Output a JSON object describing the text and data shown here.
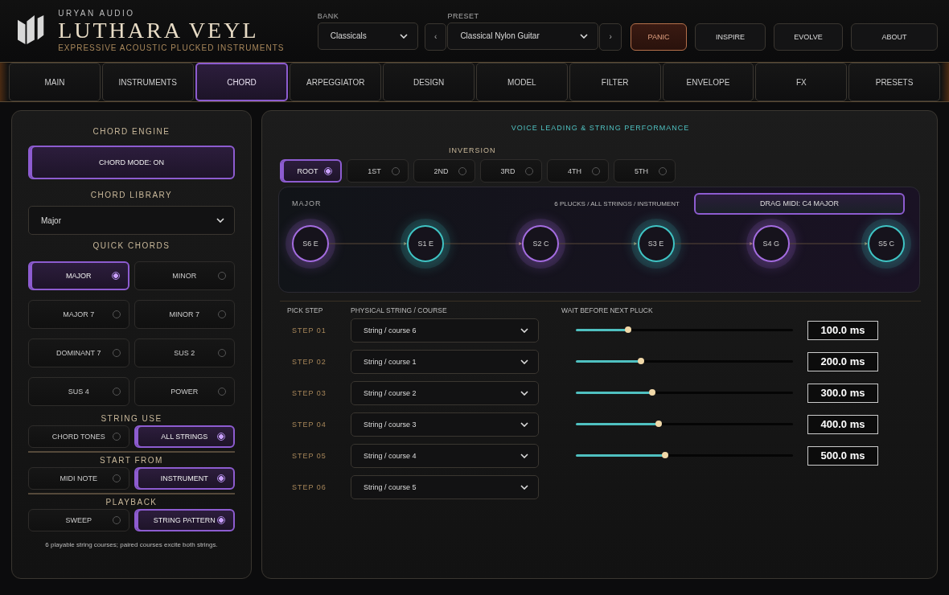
{
  "brand": {
    "company": "URYAN AUDIO",
    "title": "LUTHARA VEYL",
    "subtitle": "EXPRESSIVE ACOUSTIC PLUCKED INSTRUMENTS"
  },
  "bank": {
    "label": "BANK",
    "value": "Classicals"
  },
  "preset": {
    "label": "PRESET",
    "prev": "‹",
    "value": "Classical Nylon Guitar",
    "next": "›"
  },
  "header_buttons": [
    {
      "label": "PANIC",
      "kind": "alert"
    },
    {
      "label": "INSPIRE",
      "kind": "normal"
    },
    {
      "label": "EVOLVE",
      "kind": "normal"
    },
    {
      "label": "ABOUT",
      "kind": "normal"
    }
  ],
  "tabs": [
    {
      "label": "MAIN",
      "selected": false
    },
    {
      "label": "INSTRUMENTS",
      "selected": false
    },
    {
      "label": "CHORD",
      "selected": true
    },
    {
      "label": "ARPEGGIATOR",
      "selected": false
    },
    {
      "label": "DESIGN",
      "selected": false
    },
    {
      "label": "MODEL",
      "selected": false
    },
    {
      "label": "FILTER",
      "selected": false
    },
    {
      "label": "ENVELOPE",
      "selected": false
    },
    {
      "label": "FX",
      "selected": false
    },
    {
      "label": "PRESETS",
      "selected": false
    }
  ],
  "chord_panel": {
    "engine_title": "CHORD ENGINE",
    "chord_mode": {
      "label": "CHORD MODE: ON",
      "on": true
    },
    "library_title": "CHORD LIBRARY",
    "library_value": "Major",
    "quick_title": "QUICK CHORDS",
    "quick_chords": [
      {
        "label": "MAJOR",
        "selected": true
      },
      {
        "label": "MINOR",
        "selected": false
      },
      {
        "label": "MAJOR 7",
        "selected": false
      },
      {
        "label": "MINOR 7",
        "selected": false
      },
      {
        "label": "DOMINANT 7",
        "selected": false
      },
      {
        "label": "SUS 2",
        "selected": false
      },
      {
        "label": "SUS 4",
        "selected": false
      },
      {
        "label": "POWER",
        "selected": false
      }
    ],
    "groups": [
      {
        "title": "STRING USE",
        "options": [
          {
            "label": "CHORD TONES",
            "selected": false
          },
          {
            "label": "ALL STRINGS",
            "selected": true
          }
        ]
      },
      {
        "title": "START FROM",
        "options": [
          {
            "label": "MIDI NOTE",
            "selected": false
          },
          {
            "label": "INSTRUMENT",
            "selected": true
          }
        ]
      },
      {
        "title": "PLAYBACK",
        "options": [
          {
            "label": "SWEEP",
            "selected": false
          },
          {
            "label": "STRING PATTERN",
            "selected": true
          }
        ]
      }
    ],
    "footnote": "6 playable string courses; paired courses excite both strings."
  },
  "voice_panel": {
    "title": "VOICE LEADING & STRING PERFORMANCE",
    "inversion_title": "INVERSION",
    "inversions": [
      {
        "label": "ROOT",
        "selected": true
      },
      {
        "label": "1ST",
        "selected": false
      },
      {
        "label": "2ND",
        "selected": false
      },
      {
        "label": "3RD",
        "selected": false
      },
      {
        "label": "4TH",
        "selected": false
      },
      {
        "label": "5TH",
        "selected": false
      }
    ],
    "chord_name": "MAJOR",
    "summary": "6 PLUCKS / ALL STRINGS / INSTRUMENT",
    "drag_button": "DRAG MIDI: C4 MAJOR",
    "nodes": [
      {
        "label": "S6  E",
        "color": "#a46ce0"
      },
      {
        "label": "S1  E",
        "color": "#3fc4c4"
      },
      {
        "label": "S2  C",
        "color": "#a46ce0"
      },
      {
        "label": "S3  E",
        "color": "#3fc4c4"
      },
      {
        "label": "S4  G",
        "color": "#a46ce0"
      },
      {
        "label": "S5  C",
        "color": "#3fc4c4"
      }
    ],
    "columns": [
      "PICK STEP",
      "PHYSICAL STRING / COURSE",
      "WAIT BEFORE NEXT PLUCK"
    ],
    "steps": [
      {
        "step": "STEP 01",
        "string": "String / course 6",
        "level": 0.24,
        "wait": "100.0 ms"
      },
      {
        "step": "STEP 02",
        "string": "String / course 1",
        "level": 0.3,
        "wait": "200.0 ms"
      },
      {
        "step": "STEP 03",
        "string": "String / course 2",
        "level": 0.35,
        "wait": "300.0 ms"
      },
      {
        "step": "STEP 04",
        "string": "String / course 3",
        "level": 0.38,
        "wait": "400.0 ms"
      },
      {
        "step": "STEP 05",
        "string": "String / course 4",
        "level": 0.41,
        "wait": "500.0 ms"
      },
      {
        "step": "STEP 06",
        "string": "String / course 5"
      }
    ]
  }
}
